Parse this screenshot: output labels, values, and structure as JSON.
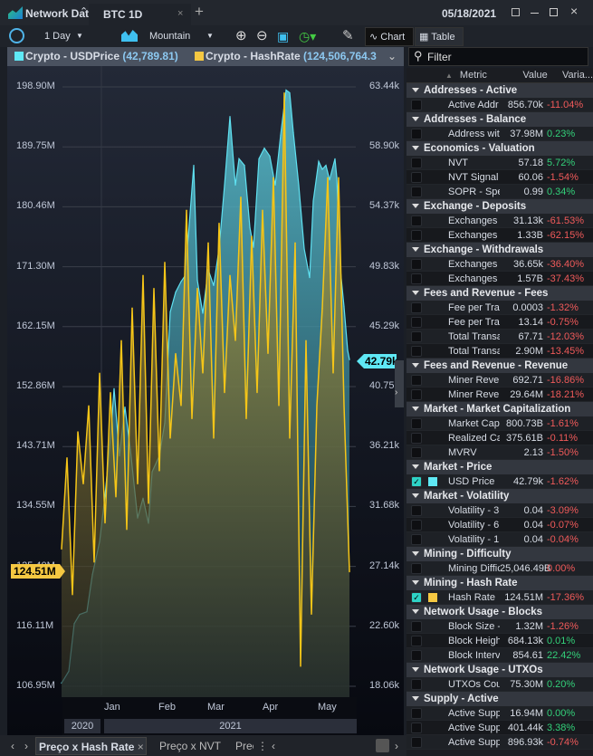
{
  "window": {
    "app_title": "Network Data",
    "tab": "BTC 1D",
    "date": "05/18/2021"
  },
  "toolbar": {
    "interval": "1 Day",
    "chart_type": "Mountain",
    "chart_label": "Chart",
    "table_label": "Table"
  },
  "legend": {
    "series1": "Crypto - USDPrice",
    "series1_value": "(42,789.81)",
    "series2": "Crypto - HashRate",
    "series2_value": "(124,506,764.3"
  },
  "filter": {
    "placeholder": "Filter"
  },
  "colors": {
    "price": "#5fe0f0",
    "hashrate": "#f5c518",
    "negative": "#f05a5a",
    "positive": "#33d17a"
  },
  "chart_data": {
    "type": "area",
    "left_axis": {
      "ticks": [
        "198.90M",
        "189.75M",
        "180.46M",
        "171.30M",
        "162.15M",
        "152.86M",
        "143.71M",
        "134.55M",
        "125.40M",
        "116.11M",
        "106.95M"
      ],
      "range": [
        106.95,
        198.9
      ]
    },
    "right_axis": {
      "ticks": [
        "63.44k",
        "58.90k",
        "54.37k",
        "49.83k",
        "45.29k",
        "40.75k",
        "36.21k",
        "31.68k",
        "27.14k",
        "22.60k",
        "18.06k"
      ],
      "range": [
        18.06,
        63.44
      ]
    },
    "x_months": [
      "Jan",
      "Feb",
      "Mar",
      "Apr",
      "May"
    ],
    "x_years": [
      "2020",
      "2021"
    ],
    "last_price_tag": "42.79k",
    "last_hashrate_tag": "124.51M",
    "series": [
      {
        "name": "Crypto - USDPrice",
        "axis": "right",
        "x": [
          "2020-12-10",
          "2020-12-14",
          "2020-12-17",
          "2020-12-20",
          "2020-12-24",
          "2020-12-27",
          "2020-12-31",
          "2021-01-03",
          "2021-01-06",
          "2021-01-08",
          "2021-01-11",
          "2021-01-14",
          "2021-01-17",
          "2021-01-21",
          "2021-01-24",
          "2021-01-27",
          "2021-01-29",
          "2021-02-02",
          "2021-02-05",
          "2021-02-08",
          "2021-02-11",
          "2021-02-14",
          "2021-02-16",
          "2021-02-18",
          "2021-02-21",
          "2021-02-23",
          "2021-02-26",
          "2021-03-01",
          "2021-03-04",
          "2021-03-07",
          "2021-03-10",
          "2021-03-13",
          "2021-03-16",
          "2021-03-18",
          "2021-03-21",
          "2021-03-24",
          "2021-03-26",
          "2021-03-29",
          "2021-04-01",
          "2021-04-04",
          "2021-04-07",
          "2021-04-10",
          "2021-04-13",
          "2021-04-15",
          "2021-04-17",
          "2021-04-20",
          "2021-04-23",
          "2021-04-26",
          "2021-04-28",
          "2021-05-01",
          "2021-05-03",
          "2021-05-05",
          "2021-05-07",
          "2021-05-10",
          "2021-05-11",
          "2021-05-13",
          "2021-05-15",
          "2021-05-17",
          "2021-05-18"
        ],
        "values": [
          18.3,
          19.2,
          22.8,
          23.5,
          23.7,
          26.5,
          29.0,
          32.5,
          36.8,
          40.6,
          35.5,
          39.2,
          36.0,
          30.8,
          32.3,
          30.4,
          34.3,
          35.5,
          38.0,
          46.4,
          47.9,
          48.7,
          49.1,
          52.1,
          57.5,
          48.8,
          46.3,
          49.6,
          48.4,
          51.2,
          56.0,
          61.2,
          56.0,
          58.0,
          57.5,
          52.8,
          51.3,
          58.0,
          58.8,
          58.2,
          56.0,
          59.8,
          63.2,
          63.0,
          60.0,
          56.0,
          51.2,
          49.0,
          54.8,
          57.8,
          57.2,
          57.5,
          56.4,
          58.0,
          56.6,
          49.6,
          46.8,
          43.5,
          42.79
        ]
      },
      {
        "name": "Crypto - HashRate",
        "axis": "left",
        "x": [
          "2020-12-10",
          "2020-12-13",
          "2020-12-16",
          "2020-12-19",
          "2020-12-22",
          "2020-12-25",
          "2020-12-28",
          "2020-12-31",
          "2021-01-03",
          "2021-01-06",
          "2021-01-09",
          "2021-01-12",
          "2021-01-15",
          "2021-01-18",
          "2021-01-21",
          "2021-01-24",
          "2021-01-27",
          "2021-01-30",
          "2021-02-02",
          "2021-02-05",
          "2021-02-08",
          "2021-02-11",
          "2021-02-14",
          "2021-02-17",
          "2021-02-20",
          "2021-02-23",
          "2021-02-26",
          "2021-03-01",
          "2021-03-04",
          "2021-03-07",
          "2021-03-10",
          "2021-03-13",
          "2021-03-16",
          "2021-03-19",
          "2021-03-22",
          "2021-03-25",
          "2021-03-28",
          "2021-03-31",
          "2021-04-03",
          "2021-04-06",
          "2021-04-09",
          "2021-04-12",
          "2021-04-15",
          "2021-04-18",
          "2021-04-21",
          "2021-04-24",
          "2021-04-27",
          "2021-04-30",
          "2021-05-03",
          "2021-05-06",
          "2021-05-09",
          "2021-05-12",
          "2021-05-15",
          "2021-05-18"
        ],
        "values": [
          128,
          142,
          121,
          146,
          138,
          150,
          126,
          155,
          132,
          152,
          136,
          160,
          131,
          165,
          138,
          170,
          135,
          168,
          140,
          172,
          145,
          158,
          150,
          180,
          148,
          168,
          155,
          175,
          145,
          178,
          152,
          170,
          160,
          182,
          148,
          176,
          152,
          180,
          158,
          185,
          150,
          198,
          145,
          175,
          110,
          160,
          118,
          150,
          165,
          185,
          155,
          185,
          150,
          124.51
        ]
      }
    ]
  },
  "panel": {
    "columns": {
      "metric": "Metric",
      "value": "Value",
      "variation": "Varia..."
    },
    "groups": [
      {
        "title": "Addresses - Active",
        "rows": [
          {
            "metric": "Active Addr",
            "value": "856.70k",
            "var": "-11.04%"
          }
        ]
      },
      {
        "title": "Addresses - Balance",
        "rows": [
          {
            "metric": "Address wit",
            "value": "37.98M",
            "var": "0.23%"
          }
        ]
      },
      {
        "title": "Economics - Valuation",
        "rows": [
          {
            "metric": "NVT",
            "value": "57.18",
            "var": "5.72%"
          },
          {
            "metric": "NVT Signal",
            "value": "60.06",
            "var": "-1.54%"
          },
          {
            "metric": "SOPR - Spe",
            "value": "0.99",
            "var": "0.34%"
          }
        ]
      },
      {
        "title": "Exchange - Deposits",
        "rows": [
          {
            "metric": "Exchanges I",
            "value": "31.13k",
            "var": "-61.53%"
          },
          {
            "metric": "Exchanges I",
            "value": "1.33B",
            "var": "-62.15%"
          }
        ]
      },
      {
        "title": "Exchange - Withdrawals",
        "rows": [
          {
            "metric": "Exchanges I",
            "value": "36.65k",
            "var": "-36.40%"
          },
          {
            "metric": "Exchanges I",
            "value": "1.57B",
            "var": "-37.43%"
          }
        ]
      },
      {
        "title": "Fees and Revenue - Fees",
        "rows": [
          {
            "metric": "Fee per Tra",
            "value": "0.0003",
            "var": "-1.32%"
          },
          {
            "metric": "Fee per Tra",
            "value": "13.14",
            "var": "-0.75%"
          },
          {
            "metric": "Total Transa",
            "value": "67.71",
            "var": "-12.03%"
          },
          {
            "metric": "Total Transa",
            "value": "2.90M",
            "var": "-13.45%"
          }
        ]
      },
      {
        "title": "Fees and Revenue - Revenue",
        "rows": [
          {
            "metric": "Miner Rever",
            "value": "692.71",
            "var": "-16.86%"
          },
          {
            "metric": "Miner Rever",
            "value": "29.64M",
            "var": "-18.21%"
          }
        ]
      },
      {
        "title": "Market - Market Capitalization",
        "rows": [
          {
            "metric": "Market Cap",
            "value": "800.73B",
            "var": "-1.61%"
          },
          {
            "metric": "Realized Ca",
            "value": "375.61B",
            "var": "-0.11%"
          },
          {
            "metric": "MVRV",
            "value": "2.13",
            "var": "-1.50%"
          }
        ]
      },
      {
        "title": "Market - Price",
        "rows": [
          {
            "metric": "USD Price",
            "value": "42.79k",
            "var": "-1.62%",
            "checked": true,
            "swatch": "#5fe8f5"
          }
        ]
      },
      {
        "title": "Market - Volatility",
        "rows": [
          {
            "metric": "Volatility - 3",
            "value": "0.04",
            "var": "-3.09%"
          },
          {
            "metric": "Volatility - 6",
            "value": "0.04",
            "var": "-0.07%"
          },
          {
            "metric": "Volatility - 1",
            "value": "0.04",
            "var": "-0.04%"
          }
        ]
      },
      {
        "title": "Mining - Difficulty",
        "rows": [
          {
            "metric": "Mining Diffic",
            "value": "25,046.49B",
            "var": "0.00%",
            "neg": true
          }
        ]
      },
      {
        "title": "Mining - Hash Rate",
        "rows": [
          {
            "metric": "Hash Rate",
            "value": "124.51M",
            "var": "-17.36%",
            "checked": true,
            "swatch": "#f5c842"
          }
        ]
      },
      {
        "title": "Network Usage - Blocks",
        "rows": [
          {
            "metric": "Block Size -",
            "value": "1.32M",
            "var": "-1.26%"
          },
          {
            "metric": "Block Height",
            "value": "684.13k",
            "var": "0.01%"
          },
          {
            "metric": "Block Interv",
            "value": "854.61",
            "var": "22.42%"
          }
        ]
      },
      {
        "title": "Network Usage - UTXOs",
        "rows": [
          {
            "metric": "UTXOs Cour",
            "value": "75.30M",
            "var": "0.20%"
          }
        ]
      },
      {
        "title": "Supply - Active",
        "rows": [
          {
            "metric": "Active Supp",
            "value": "16.94M",
            "var": "0.00%"
          },
          {
            "metric": "Active Supp",
            "value": "401.44k",
            "var": "3.38%"
          },
          {
            "metric": "Active Supp",
            "value": "896.93k",
            "var": "-0.74%"
          }
        ]
      }
    ]
  },
  "bottom_tabs": {
    "active": "Preço x Hash Rate",
    "tab2": "Preço x NVT",
    "tab3": "Preç"
  }
}
